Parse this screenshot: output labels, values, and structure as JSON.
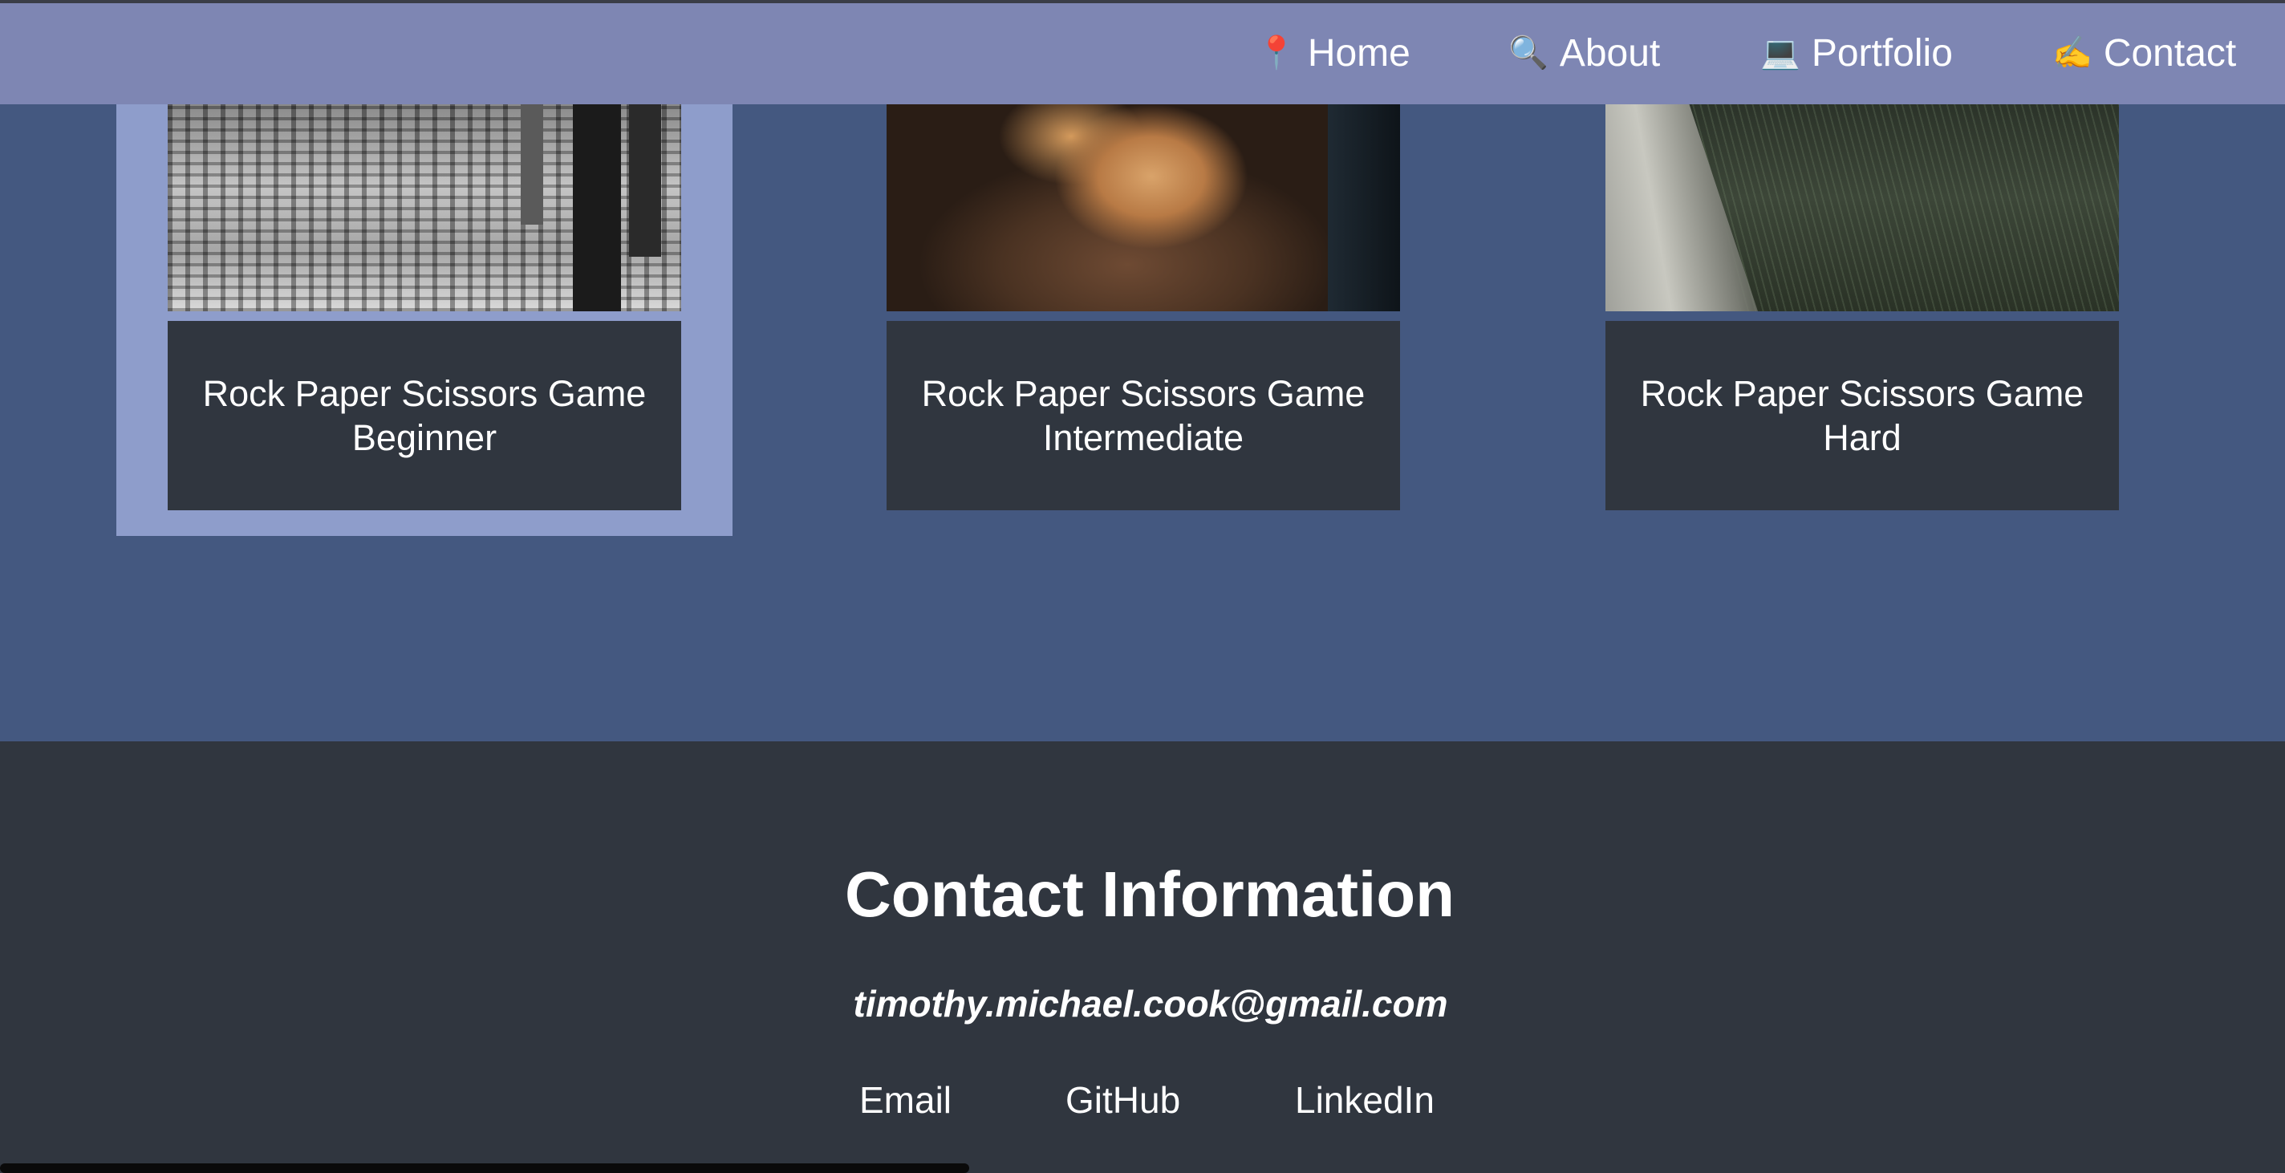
{
  "nav": {
    "items": [
      {
        "icon": "📍",
        "icon_name": "pin-icon",
        "label": "Home"
      },
      {
        "icon": "🔍",
        "icon_name": "magnifier-icon",
        "label": "About"
      },
      {
        "icon": "💻",
        "icon_name": "laptop-icon",
        "label": "Portfolio"
      },
      {
        "icon": "✍️",
        "icon_name": "writing-hand-icon",
        "label": "Contact"
      }
    ]
  },
  "portfolio": {
    "cards": [
      {
        "title": "Rock Paper Scissors Game Beginner",
        "image": "city-skyline-image"
      },
      {
        "title": "Rock Paper Scissors Game Intermediate",
        "image": "tiger-paw-image"
      },
      {
        "title": "Rock Paper Scissors Game Hard",
        "image": "forest-grass-image"
      }
    ]
  },
  "footer": {
    "title": "Contact Information",
    "email": "timothy.michael.cook@gmail.com",
    "links": [
      "Email",
      "GitHub",
      "LinkedIn"
    ]
  },
  "colors": {
    "navbar": "#7e86b3",
    "page_background": "#445880",
    "card_body": "#30363f",
    "card_highlight": "#8e9dcb",
    "footer": "#30363f",
    "text": "#ffffff"
  }
}
